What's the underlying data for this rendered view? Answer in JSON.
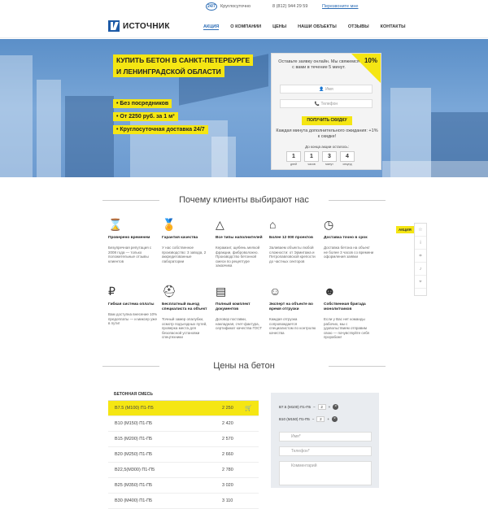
{
  "topbar": {
    "badge": "24/7",
    "text": "Круглосуточно",
    "phone": "8 (812) 944 29 59",
    "callback": "Перезвоните мне"
  },
  "header": {
    "logo": "ИСТОЧНИК",
    "nav": [
      "АКЦИЯ",
      "О КОМПАНИИ",
      "ЦЕНЫ",
      "НАШИ ОБЪЕКТЫ",
      "ОТЗЫВЫ",
      "КОНТАКТЫ"
    ]
  },
  "hero": {
    "title1": "КУПИТЬ БЕТОН В САНКТ-ПЕТЕРБУРГЕ",
    "title2": "И ЛЕНИНГРАДСКОЙ ОБЛАСТИ",
    "bullets": [
      "• Без посредников",
      "• От 2250 руб. за 1 м³",
      "• Круглосуточная доставка 24/7"
    ]
  },
  "form": {
    "badge": "10%",
    "title": "Оставьте заявку онлайн. Мы свяжемся с вами в течение 5 минут.",
    "name_placeholder": "Имя",
    "phone_placeholder": "Телефон",
    "button": "ПОЛУЧИТЬ СКИДКУ",
    "note": "Каждая минута дополнительного ожидания: +1% к скидке!",
    "countdown_label": "До конца акции осталось:",
    "digits": [
      {
        "n": "1",
        "l": "дней"
      },
      {
        "n": "1",
        "l": "часов"
      },
      {
        "n": "3",
        "l": "минут"
      },
      {
        "n": "4",
        "l": "секунд"
      }
    ]
  },
  "why": {
    "title": "Почему клиенты выбирают нас",
    "features": [
      {
        "icon": "hourglass-icon",
        "glyph": "⌛",
        "t": "Проверено временем",
        "d": "Безупречная репутация с 2008 года — только положительные отзывы клиентов"
      },
      {
        "icon": "medal-icon",
        "glyph": "🏅",
        "t": "Гарантия качества",
        "d": "У нас собственное производство: 3 завода, 2 аккредитованные лаборатории"
      },
      {
        "icon": "shapes-icon",
        "glyph": "△",
        "t": "Все типы наполнителей",
        "d": "Керамзит, щебень мелкой фракции, фиброволокно. Производство бетонной смеси по рецептуре заказчика"
      },
      {
        "icon": "warehouse-icon",
        "glyph": "⌂",
        "t": "Более 12 000 проектов",
        "d": "Заливаем объекты любой сложности: от Эрмитажа и Петропавловской крепости до частных секторов"
      },
      {
        "icon": "clock-icon",
        "glyph": "◷",
        "t": "Доставка точно в срок",
        "d": "Доставка бетона на объект не более 3 часов со времени оформления заявки"
      },
      {
        "icon": "ruble-icon",
        "glyph": "₽",
        "t": "Гибкая система оплаты",
        "d": "Вам доступна внесение 10% предоплаты — и миксер уже в пути!"
      },
      {
        "icon": "helmet-icon",
        "glyph": "⛑",
        "t": "Бесплатный выезд специалиста на объект",
        "d": "Точный замер опалубки, осмотр подъездных путей, проверка места для безопасной установки спецтехники"
      },
      {
        "icon": "document-icon",
        "glyph": "▤",
        "t": "Полный комплект документов",
        "d": "Договор поставки, накладная, счет-фактура, сертификат качества ГОСТ"
      },
      {
        "icon": "expert-icon",
        "glyph": "☺",
        "t": "Эксперт на объекте во время отгрузки",
        "d": "Каждая отгрузка сопровождается специалистом по контролю качества"
      },
      {
        "icon": "team-icon",
        "glyph": "☻",
        "t": "Собственная бригада монолитчиков",
        "d": "Если у Вас нет команды рабочих, мы с удовольствием отправим свою — почувствуйте себя прорабом!"
      }
    ]
  },
  "sidebar": {
    "akcia": "АКЦИЯ"
  },
  "prices": {
    "title": "Цены на бетон",
    "header": "БЕТОННАЯ СМЕСЬ",
    "rows": [
      {
        "n": "В7.5 (М100) П1-П5",
        "v": "2 250"
      },
      {
        "n": "В10 (М150) П1-П5",
        "v": "2 420"
      },
      {
        "n": "В15 (М200) П1-П5",
        "v": "2 570"
      },
      {
        "n": "В20 (М250) П1-П5",
        "v": "2 660"
      },
      {
        "n": "В22,5(М300) П1-П5",
        "v": "2 780"
      },
      {
        "n": "В25 (М350) П1-П5",
        "v": "3 020"
      },
      {
        "n": "В30 (М400) П1-П5",
        "v": "3 110"
      }
    ]
  },
  "order": {
    "items": [
      {
        "n": "В7.5 (М100) П1-П5",
        "q": "2"
      },
      {
        "n": "В10 (М150) П1-П5",
        "q": "2"
      }
    ],
    "name": "Имя*",
    "phone": "Телефон*",
    "comment": "Комментарий"
  }
}
